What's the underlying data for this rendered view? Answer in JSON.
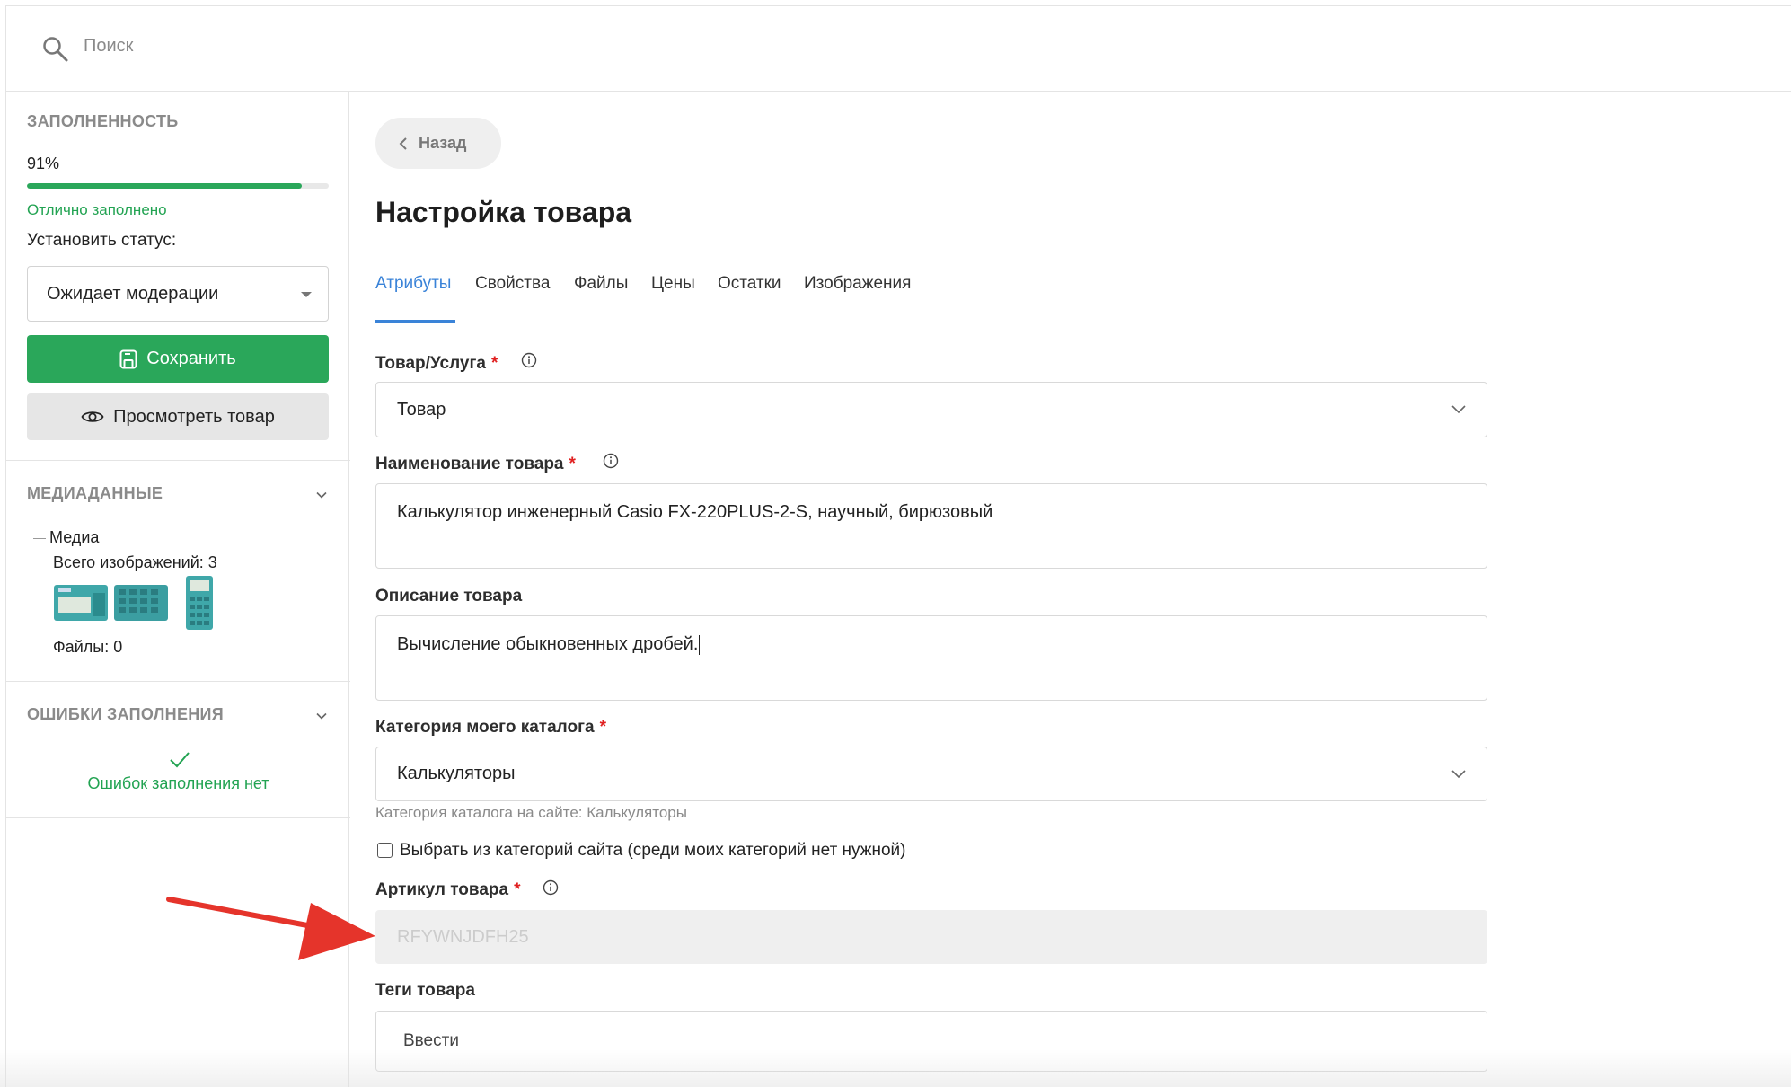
{
  "search": {
    "placeholder": "Поиск"
  },
  "sidebar": {
    "fill": {
      "title": "Заполненность",
      "percent_text": "91%",
      "progress": 0.91,
      "status_text": "Отлично заполнено"
    },
    "status": {
      "label": "Установить статус:",
      "selected": "Ожидает модерации"
    },
    "save_label": "Сохранить",
    "view_label": "Просмотреть товар",
    "media": {
      "title": "Медиаданные",
      "group_label": "Медиа",
      "images_count": "Всего изображений: 3",
      "files_count": "Файлы: 0"
    },
    "errors": {
      "title": "Ошибки заполнения",
      "message": "Ошибок заполнения нет"
    }
  },
  "main": {
    "back_label": "Назад",
    "title": "Настройка товара",
    "tabs": [
      "Атрибуты",
      "Свойства",
      "Файлы",
      "Цены",
      "Остатки",
      "Изображения"
    ],
    "active_tab": "Атрибуты",
    "fields": {
      "type": {
        "label": "Товар/Услуга",
        "value": "Товар"
      },
      "name": {
        "label": "Наименование товара",
        "value": "Калькулятор инженерный Casio FX-220PLUS-2-S, научный, бирюзовый"
      },
      "description": {
        "label": "Описание товара",
        "value": "Вычисление обыкновенных дробей."
      },
      "category": {
        "label": "Категория моего каталога",
        "value": "Калькуляторы",
        "helper": "Категория каталога на сайте: Калькуляторы"
      },
      "site_category_checkbox": {
        "label": "Выбрать из категорий сайта (среди моих категорий нет нужной)",
        "checked": false
      },
      "sku": {
        "label": "Артикул товара",
        "value": "RFYWNJDFH25"
      },
      "tags": {
        "label": "Теги товара",
        "placeholder": "Ввести"
      }
    },
    "required_mark": "*"
  },
  "colors": {
    "accent_green": "#2aa75a",
    "accent_blue": "#3a83d8",
    "required_red": "#e02020",
    "annotation_arrow": "#e5342b"
  }
}
